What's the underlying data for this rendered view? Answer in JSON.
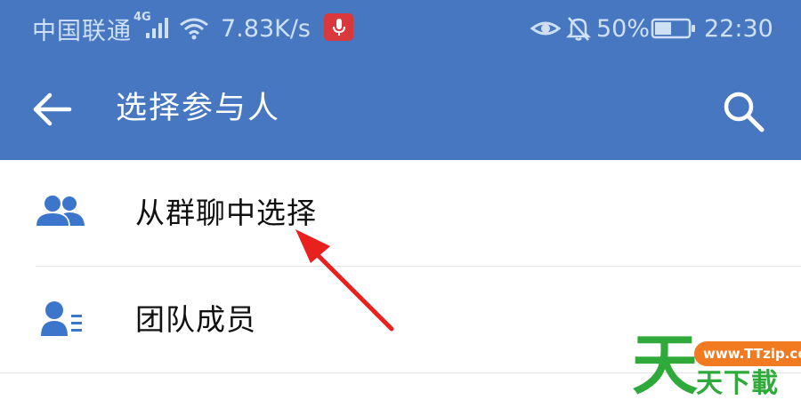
{
  "status_bar": {
    "carrier": "中国联通",
    "network_type": "4G",
    "speed": "7.83K/s",
    "battery_percent": "50%",
    "battery_level": 0.5,
    "time": "22:30"
  },
  "app_bar": {
    "title": "选择参与人"
  },
  "list": {
    "items": [
      {
        "label": "从群聊中选择",
        "icon": "group-icon"
      },
      {
        "label": "团队成员",
        "icon": "contact-list-icon"
      }
    ]
  },
  "watermark": {
    "big_char": "天",
    "url": "www.TTzip.com",
    "text": "天下載"
  },
  "colors": {
    "primary": "#4677c0",
    "icon_blue": "#3c76cc",
    "arrow_red": "#e8201e",
    "watermark_green": "#2faa3a",
    "watermark_orange": "#f27b21"
  }
}
